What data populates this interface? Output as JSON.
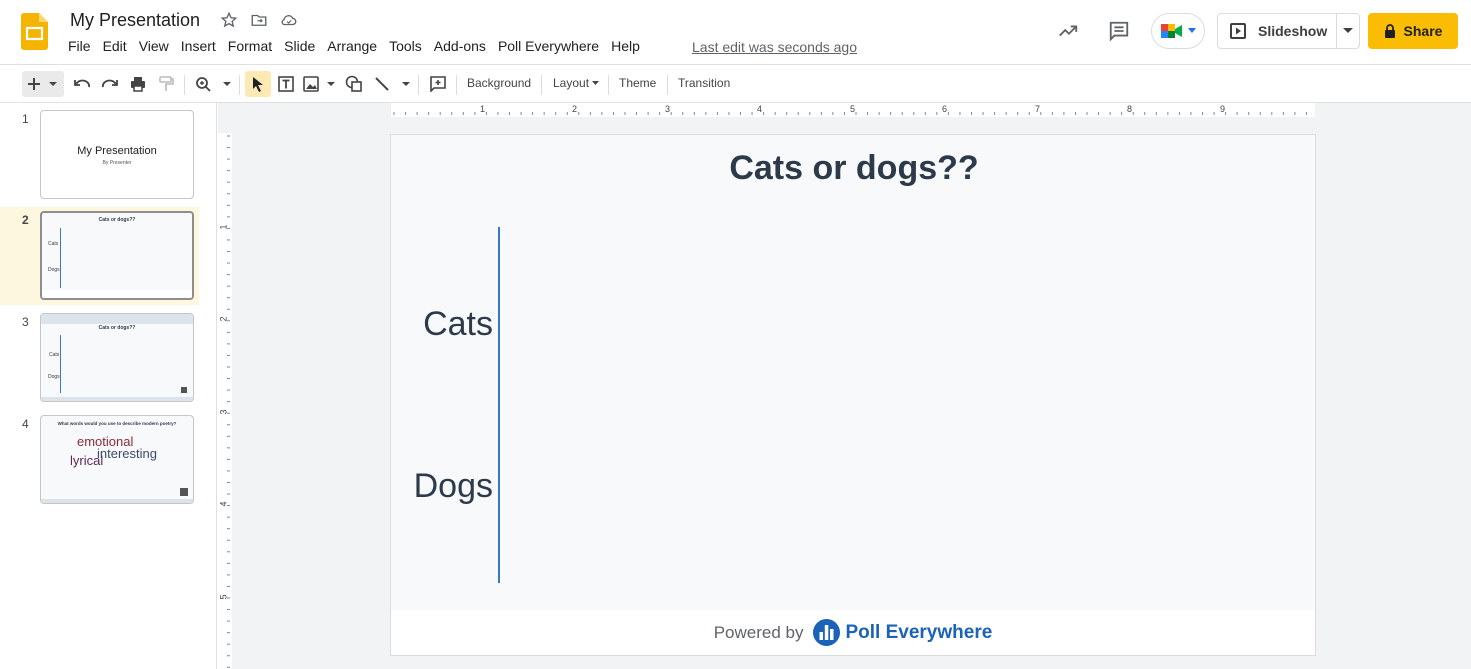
{
  "app": {
    "title": "My Presentation",
    "menu": [
      "File",
      "Edit",
      "View",
      "Insert",
      "Format",
      "Slide",
      "Arrange",
      "Tools",
      "Add-ons",
      "Poll Everywhere",
      "Help"
    ],
    "last_edit": "Last edit was seconds ago",
    "slideshow_label": "Slideshow",
    "share_label": "Share",
    "accent": "#fbbc04"
  },
  "toolbar": {
    "background": "Background",
    "layout": "Layout",
    "theme": "Theme",
    "transition": "Transition"
  },
  "filmstrip": {
    "slides": [
      {
        "num": "1",
        "title": "My Presentation",
        "subtitle": "By Presenter"
      },
      {
        "num": "2",
        "title": "Cats or dogs??",
        "labels": [
          "Cats",
          "Dogs"
        ]
      },
      {
        "num": "3",
        "title": "Cats or dogs??",
        "labels": [
          "Cats",
          "Dogs"
        ]
      },
      {
        "num": "4",
        "title": "What words would you use to describe modern poetry?",
        "words": [
          "emotional",
          "interesting",
          "lyrical"
        ]
      }
    ]
  },
  "ruler": {
    "h": [
      "1",
      "2",
      "3",
      "4",
      "5",
      "6",
      "7",
      "8",
      "9"
    ],
    "v": [
      "1",
      "2",
      "3",
      "4",
      "5"
    ]
  },
  "slide": {
    "title": "Cats or dogs??",
    "categories": [
      "Cats",
      "Dogs"
    ],
    "powered_by": "Powered by",
    "brand": "Poll Everywhere",
    "axis_color": "#3b78c2"
  }
}
